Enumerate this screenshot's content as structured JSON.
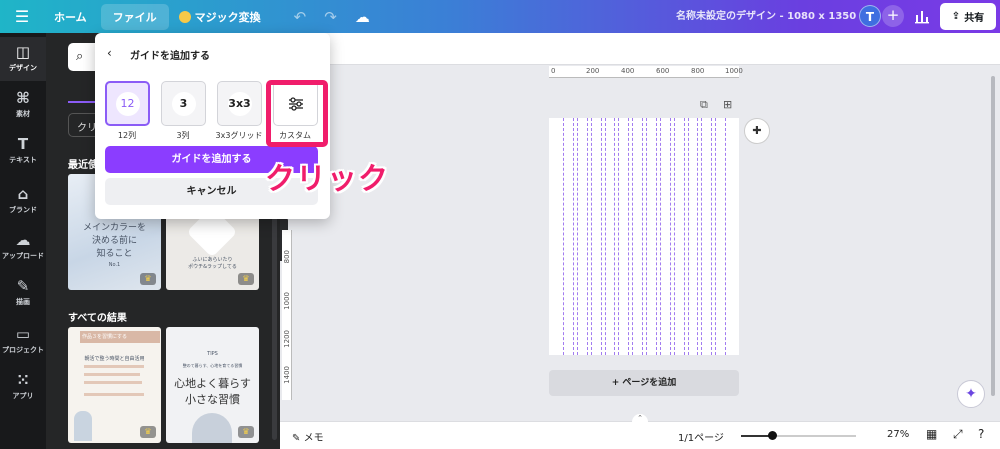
{
  "topbar": {
    "home": "ホーム",
    "file": "ファイル",
    "magic": "マジック変換",
    "doc_title": "名称未設定のデザイン - 1080 x 1350 px",
    "avatar_initial": "T",
    "share": "共有"
  },
  "rail": {
    "items": [
      {
        "label": "デザイン",
        "icon": "design-icon",
        "glyph": "◫"
      },
      {
        "label": "素材",
        "icon": "elements-icon",
        "glyph": "⌘"
      },
      {
        "label": "テキスト",
        "icon": "text-icon",
        "glyph": "T"
      },
      {
        "label": "ブランド",
        "icon": "brand-icon",
        "glyph": "⌂"
      },
      {
        "label": "アップロード",
        "icon": "upload-icon",
        "glyph": "☁"
      },
      {
        "label": "描画",
        "icon": "draw-icon",
        "glyph": "✎"
      },
      {
        "label": "プロジェクト",
        "icon": "folder-icon",
        "glyph": "▭"
      },
      {
        "label": "アプリ",
        "icon": "apps-icon",
        "glyph": "⁙"
      }
    ]
  },
  "panel": {
    "filter_chip": "クリ",
    "recent_title": "最近使",
    "all_results": "すべての結果",
    "thumb1_line1": "メインカラーを",
    "thumb1_line2": "決める前に",
    "thumb1_line3": "知ること",
    "thumb1_small": "No.1",
    "thumb2_line1": "ふいにあらいたり",
    "thumb2_line2": "ポウチ&ラップしてる",
    "thumb3_badge": "作品３を習慣にする",
    "thumb3_title": "朝活で整う時間と自由活用",
    "thumb4_tag": "TIPS",
    "thumb4_line0": "整のて暮らす、心地を育てる習慣",
    "thumb4_line1": "心地よく暮らす",
    "thumb4_line2": "小さな習慣"
  },
  "popover": {
    "title": "ガイドを追加する",
    "options": [
      {
        "value": "12",
        "label": "12列"
      },
      {
        "value": "3",
        "label": "3列"
      },
      {
        "value": "3x3",
        "label": "3x3グリッド"
      },
      {
        "value": "",
        "label": "カスタム",
        "icon": "sliders-icon"
      }
    ],
    "primary": "ガイドを追加する",
    "cancel": "キャンセル"
  },
  "annotation": {
    "text": "クリック",
    "color": "#f01d6b"
  },
  "canvas": {
    "ruler_h": [
      "0",
      "200",
      "400",
      "600",
      "800",
      "1000"
    ],
    "ruler_v": [
      "800",
      "1000",
      "1200",
      "1400"
    ],
    "guide_columns": 12,
    "add_page": "+ ページを追加"
  },
  "bottombar": {
    "memo": "メモ",
    "page_counter": "1/1ページ",
    "zoom": "27%",
    "zoom_fraction": 0.27
  }
}
